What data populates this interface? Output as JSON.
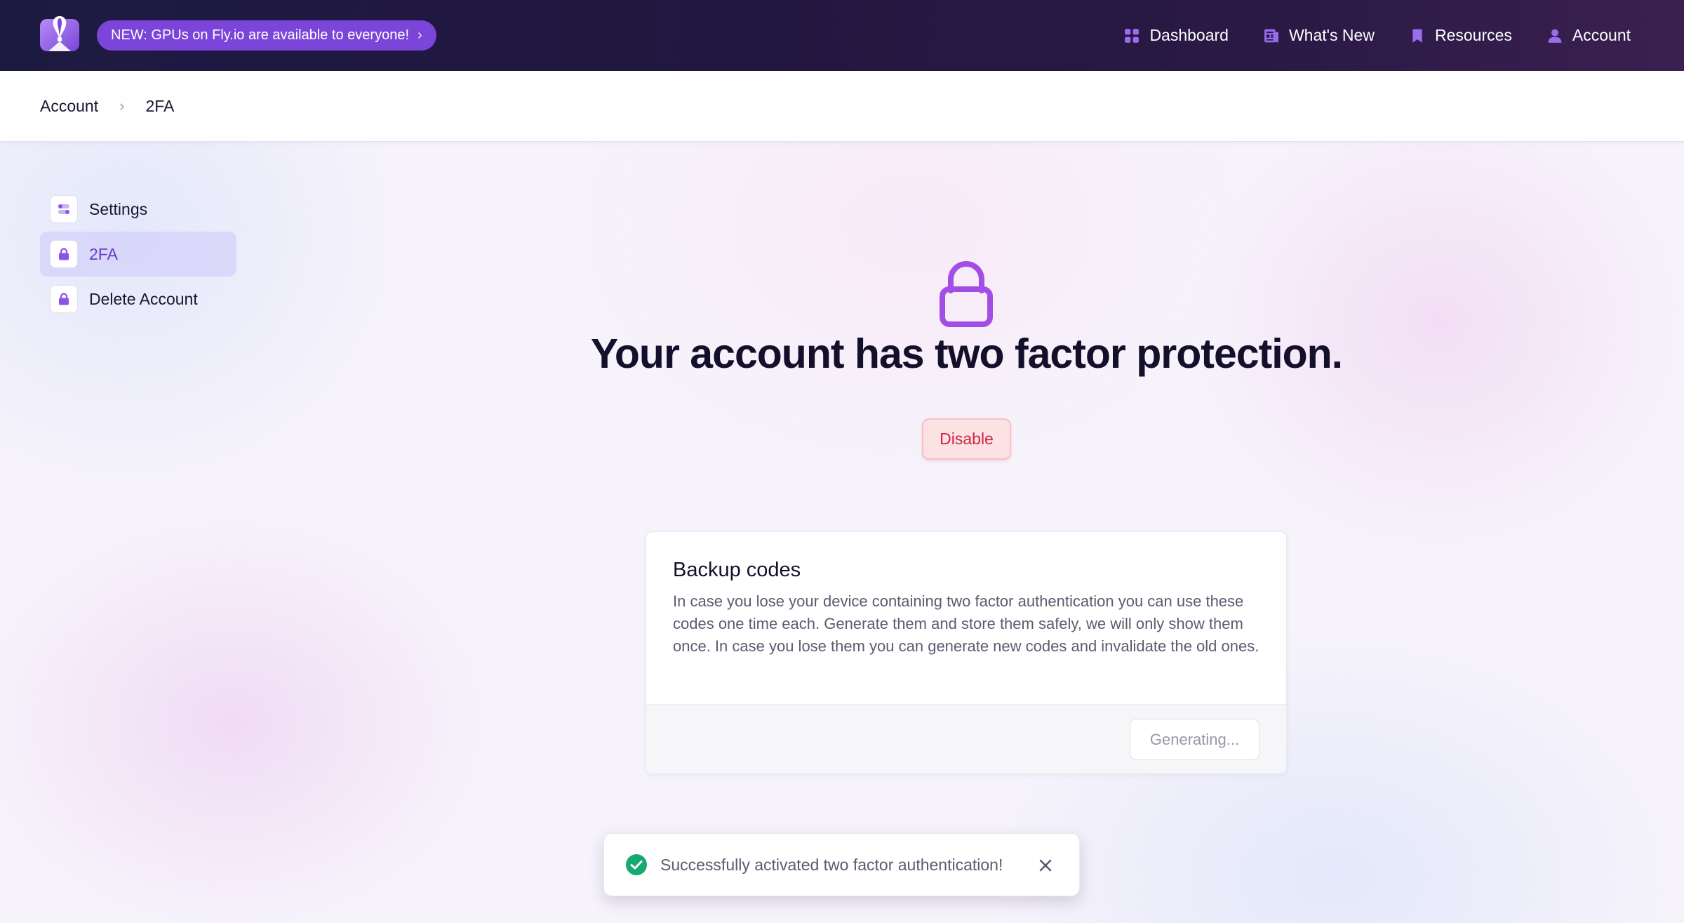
{
  "topnav": {
    "logo_name": "fly-balloon-logo",
    "announcement": "NEW: GPUs on Fly.io are available to everyone!",
    "links": [
      {
        "label": "Dashboard",
        "icon": "grid-icon"
      },
      {
        "label": "What's New",
        "icon": "newspaper-icon"
      },
      {
        "label": "Resources",
        "icon": "bookmark-icon"
      },
      {
        "label": "Account",
        "icon": "user-icon"
      }
    ]
  },
  "breadcrumb": [
    "Account",
    "2FA"
  ],
  "sidebar": {
    "items": [
      {
        "label": "Settings",
        "icon": "toggles-icon",
        "active": false
      },
      {
        "label": "2FA",
        "icon": "lock-icon",
        "active": true
      },
      {
        "label": "Delete Account",
        "icon": "lock-icon",
        "active": false
      }
    ]
  },
  "main": {
    "title": "Your account has two factor protection.",
    "disable_label": "Disable",
    "backup": {
      "title": "Backup codes",
      "text": "In case you lose your device containing two factor authentication you can use these codes one time each. Generate them and store them safely, we will only show them once. In case you lose them you can generate new codes and invalidate the old ones.",
      "button_label": "Generating..."
    }
  },
  "toast": {
    "message": "Successfully activated two factor authentication!"
  },
  "colors": {
    "accent": "#7a45d8",
    "lock": "#a24ee6",
    "danger": "#d02545",
    "success": "#16a970"
  }
}
